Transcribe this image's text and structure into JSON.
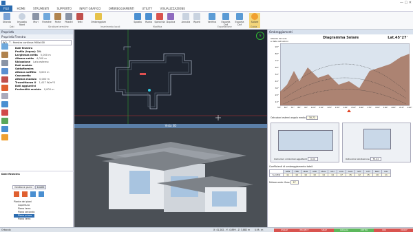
{
  "menu": [
    "FILE",
    "HOME",
    "STRUMENTI",
    "SUPPORTO",
    "INPUT GRAFICO",
    "OMBREGGIAMENTI",
    "UTILITY",
    "VISUALIZZAZIONE"
  ],
  "ribbon": {
    "buttons": [
      "Sfondo",
      "Imposta Nord",
      "Muri",
      "Finestre",
      "Porte",
      "Pilastri",
      "Tetti",
      "Ombreggiam",
      "Sposta",
      "Ruota",
      "Specchia",
      "Duplica",
      "Annulla",
      "Ripeti",
      "Verifica",
      "Esporta Dxf",
      "Esporta Dxf",
      "Solare"
    ],
    "groups": [
      "Dati",
      "Strutture termiche",
      "Inserimento locali",
      "Modifica",
      "Esportazione",
      "Guida"
    ]
  },
  "left": {
    "title": "Proprietà",
    "subtitle": "Proprietà Finestra",
    "selector": "W3 - T - finestra continua 900x400",
    "props": [
      [
        "Dati finestra",
        ""
      ],
      [
        "Profilo (legno): 1%",
        ""
      ],
      [
        "Larghezza netta",
        "5,000 m"
      ],
      [
        "Altezza netta",
        "4,000 m"
      ],
      [
        "Ubicazione",
        "Lato esterno"
      ],
      [
        "Dati modulo",
        ""
      ],
      [
        "Sottofinestra",
        ""
      ],
      [
        "Altezza soffitto",
        "3,000 m"
      ],
      [
        "Cassonetto",
        ""
      ],
      [
        "Altezza modulo",
        "0,000 m"
      ],
      [
        "Trasmittanza U",
        "1,417 W/m²K"
      ],
      [
        "Dati aggiuntivi",
        ""
      ],
      [
        "Profondità modulo",
        "0,000 m"
      ]
    ],
    "footerTitle": "Dati finestra",
    "tabs": [
      "Gestione piani",
      "Livelli"
    ],
    "tree": [
      "Piante dei piani",
      "Copertura",
      "Piano terra",
      "Piano secondo",
      "Piano primo",
      "Piano terra"
    ]
  },
  "view3d_title": "Vista 3D",
  "solar": {
    "panel_title": "Ombreggiamenti",
    "chart_title": "Diagramma Solare",
    "latitude": "Lat.45°27'",
    "yaxis_title": "Altezza del sole\ne delle ostruzioni",
    "yticks": [
      "90°",
      "80°",
      "70°",
      "60°",
      "50°",
      "40°",
      "30°",
      "20°",
      "10°"
    ],
    "xticks": [
      "50°",
      "60°",
      "70°",
      "80°",
      "90°",
      "100°",
      "110°",
      "120°",
      "130°",
      "140°",
      "150°",
      "160°",
      "170°",
      "180°",
      "190°",
      "200°",
      "210°",
      "220°"
    ],
    "obst_label": "Ostruzioni esterni angolo medio",
    "obst_value": "30,72",
    "overhang_label": "Ostruzioni orizzontali aggettanti",
    "overhang_value": "0.00",
    "fin_label": "Ostruzioni lato/balcone",
    "fin_value": "55.02",
    "coef_title": "Coefficienti di ombreggiamento totali",
    "months": [
      "GEN",
      "FEB",
      "MAR",
      "APR",
      "MAG",
      "GIU",
      "LUG",
      "AGO",
      "SET",
      "OTT",
      "NOV",
      "DIC"
    ],
    "row_label": "Sud-Est",
    "row_values": [
      "11",
      "10",
      "10",
      "10",
      "14",
      "14",
      "17",
      "15",
      "12",
      "15",
      "10",
      "11"
    ],
    "factor_label": "Fattore ombr. fisso",
    "factor_value": "27"
  },
  "status": {
    "left": "Ortocolo",
    "coords": "X: 41,282 - Y: -0,899 - Z: 3,882 m",
    "unit": "U.M.: m",
    "badges": [
      "OSNAP",
      "PROJECT",
      "SNAP",
      "GRIGLIA",
      "ORTHO",
      "CRS",
      "MODIF"
    ]
  }
}
